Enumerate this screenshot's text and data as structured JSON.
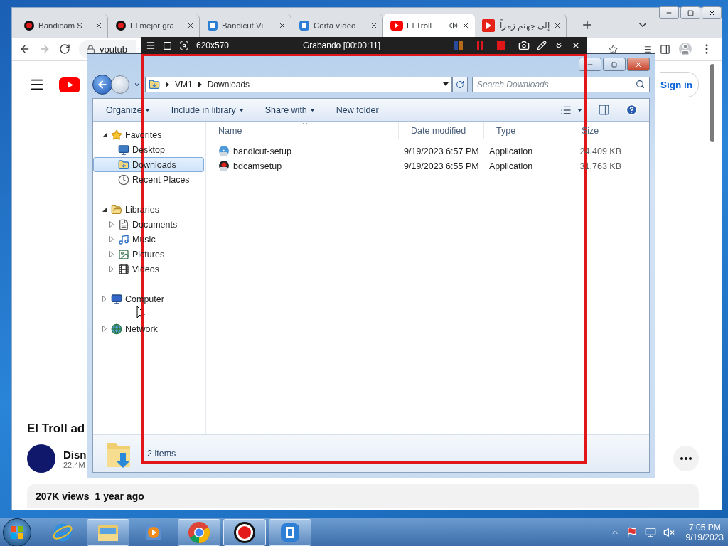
{
  "browser": {
    "tabs": [
      {
        "label": "Bandicam S",
        "kind": "record",
        "selected": false,
        "audio": false
      },
      {
        "label": "El mejor gra",
        "kind": "record",
        "selected": false,
        "audio": false
      },
      {
        "label": "Bandicut Vi",
        "kind": "bandicut",
        "selected": false,
        "audio": false
      },
      {
        "label": "Corta vídeo",
        "kind": "bandicut",
        "selected": false,
        "audio": false
      },
      {
        "label": "El Troll",
        "kind": "youtube",
        "selected": true,
        "audio": true
      },
      {
        "label": "إلى جهنم زمراً",
        "kind": "play",
        "selected": false,
        "audio": false
      }
    ],
    "nav_buttons": [
      {
        "kind": "back",
        "disabled": false
      },
      {
        "kind": "forward",
        "disabled": true
      },
      {
        "kind": "reload",
        "disabled": false
      }
    ],
    "address": {
      "value": "youtub",
      "secure": true
    },
    "youtube": {
      "sign_in": "Sign in",
      "video_title": "El Troll ad",
      "channel": "Disn",
      "subscribers": "22.4M",
      "views": "207K views",
      "age": "1 year ago"
    }
  },
  "recorder": {
    "size": "620x570",
    "status": "Grabando [00:00:11]"
  },
  "explorer": {
    "path": [
      "VM1",
      "Downloads"
    ],
    "search_placeholder": "Search Downloads",
    "commands": [
      {
        "label": "Organize",
        "dropdown": true
      },
      {
        "label": "Include in library",
        "dropdown": true
      },
      {
        "label": "Share with",
        "dropdown": true
      },
      {
        "label": "New folder",
        "dropdown": false
      }
    ],
    "nav_tree": [
      {
        "label": "Favorites",
        "kind": "favorites",
        "selected": false,
        "expanded": true,
        "children": [
          {
            "label": "Desktop",
            "kind": "desktop",
            "selected": false
          },
          {
            "label": "Downloads",
            "kind": "downloads",
            "selected": true
          },
          {
            "label": "Recent Places",
            "kind": "recent",
            "selected": false
          }
        ]
      },
      {
        "label": "Libraries",
        "kind": "libraries",
        "selected": false,
        "expanded": true,
        "children": [
          {
            "label": "Documents",
            "kind": "documents",
            "selected": false,
            "expanded": false
          },
          {
            "label": "Music",
            "kind": "music",
            "selected": false,
            "expanded": false
          },
          {
            "label": "Pictures",
            "kind": "pictures",
            "selected": false,
            "expanded": false
          },
          {
            "label": "Videos",
            "kind": "videos",
            "selected": false,
            "expanded": false
          }
        ]
      },
      {
        "label": "Computer",
        "kind": "computer",
        "selected": false,
        "expanded": false
      },
      {
        "label": "Network",
        "kind": "network",
        "selected": false,
        "expanded": false
      }
    ],
    "columns": [
      {
        "label": "Name",
        "sorted": true
      },
      {
        "label": "Date modified",
        "sorted": false
      },
      {
        "label": "Type",
        "sorted": false
      },
      {
        "label": "Size",
        "sorted": false
      }
    ],
    "files": [
      {
        "name": "bandicut-setup",
        "kind": "bandicut",
        "date": "9/19/2023 6:57 PM",
        "type": "Application",
        "size": "24,409 KB"
      },
      {
        "name": "bdcamsetup",
        "kind": "bandicam",
        "date": "9/19/2023 6:55 PM",
        "type": "Application",
        "size": "31,763 KB"
      }
    ],
    "status": "2 items"
  },
  "taskbar": {
    "apps": [
      {
        "kind": "ie",
        "running": false
      },
      {
        "kind": "explorer",
        "running": true
      },
      {
        "kind": "media",
        "running": false
      },
      {
        "kind": "chrome",
        "running": true
      },
      {
        "kind": "bandicam",
        "running": true
      },
      {
        "kind": "bandicut",
        "running": true
      }
    ],
    "clock": {
      "time": "7:05 PM",
      "date": "9/19/2023"
    }
  }
}
